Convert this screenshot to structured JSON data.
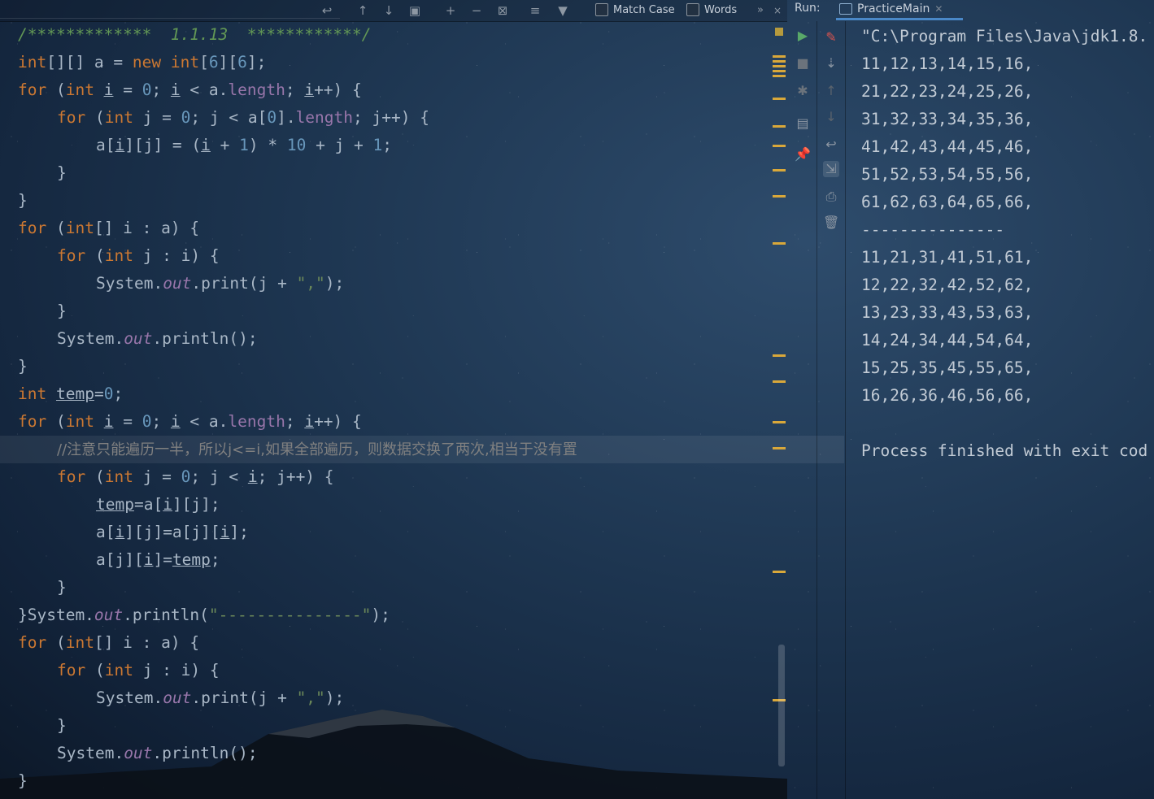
{
  "toolbar": {
    "match_case_label": "Match Case",
    "words_label": "Words",
    "more_label": "»"
  },
  "run": {
    "label": "Run:",
    "tab_label": "PracticeMain"
  },
  "code": {
    "l1_comment": "/*************  1.1.13  ************/",
    "cn_comment": "//注意只能遍历一半，所以j<=i,如果全部遍历，则数据交换了两次,相当于没有置",
    "sep_string": "\"---------------\""
  },
  "console": {
    "lines": [
      "\"C:\\Program Files\\Java\\jdk1.8.",
      "11,12,13,14,15,16,",
      "21,22,23,24,25,26,",
      "31,32,33,34,35,36,",
      "41,42,43,44,45,46,",
      "51,52,53,54,55,56,",
      "61,62,63,64,65,66,",
      "---------------",
      "11,21,31,41,51,61,",
      "12,22,32,42,52,62,",
      "13,23,33,43,53,63,",
      "14,24,34,44,54,64,",
      "15,25,35,45,55,65,",
      "16,26,36,46,56,66,",
      "",
      "Process finished with exit cod"
    ]
  },
  "icons": {
    "run": "play-icon",
    "stop": "stop-icon",
    "rerun": "rerun-icon",
    "sort": "sort-icon",
    "up": "up-arrow-icon",
    "down": "down-arrow-icon",
    "wrap": "soft-wrap-icon",
    "scroll_end": "scroll-to-end-icon",
    "print": "print-icon",
    "trash": "trash-icon",
    "pin": "pin-icon",
    "layout": "layout-icon",
    "debug": "debug-icon",
    "clear": "clear-icon"
  },
  "colors": {
    "keyword": "#cc7832",
    "number": "#6897bb",
    "string": "#6a8759",
    "field": "#9876aa",
    "comment": "#808080",
    "doc_comment": "#629755",
    "marker": "#d9a83a",
    "accent": "#4a88c7"
  }
}
